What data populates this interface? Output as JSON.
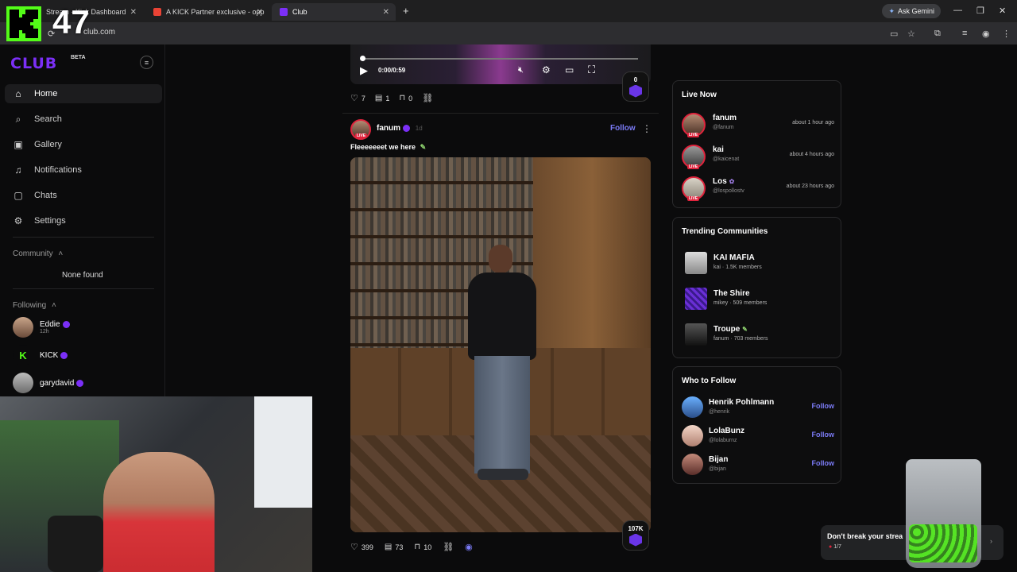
{
  "browser": {
    "tabs": [
      {
        "label": "Stream - Kick Dashboard",
        "color": "#53fc18"
      },
      {
        "label": "A KICK Partner exclusive - opp",
        "color": "#ea4335"
      },
      {
        "label": "Club",
        "color": "#7b2ff7"
      }
    ],
    "url": "club.com",
    "gemini_label": "Ask Gemini"
  },
  "overlay": {
    "viewer_count": "47"
  },
  "sidebar": {
    "logo": "CLUB",
    "beta": "BETA",
    "nav": [
      {
        "label": "Home",
        "icon": "home-icon"
      },
      {
        "label": "Search",
        "icon": "search-icon"
      },
      {
        "label": "Gallery",
        "icon": "gallery-icon"
      },
      {
        "label": "Notifications",
        "icon": "bell-icon"
      },
      {
        "label": "Chats",
        "icon": "chat-icon"
      },
      {
        "label": "Settings",
        "icon": "gear-icon"
      }
    ],
    "community_label": "Community",
    "community_empty": "None found",
    "following_label": "Following",
    "following": [
      {
        "name": "Eddie",
        "sub": "12h"
      },
      {
        "name": "KICK",
        "sub": ""
      },
      {
        "name": "garydavid",
        "sub": ""
      }
    ]
  },
  "video": {
    "time": "0:00/0:59",
    "likes": "7",
    "comments": "1",
    "bookmarks": "0",
    "gems": "0"
  },
  "post": {
    "author": "fanum",
    "age": "1d",
    "follow_label": "Follow",
    "caption": "Fleeeeeeet we here",
    "likes": "399",
    "comments": "73",
    "bookmarks": "10",
    "gems": "107K"
  },
  "live_now": {
    "title": "Live Now",
    "tag": "LIVE",
    "items": [
      {
        "name": "fanum",
        "handle": "@fanum",
        "time": "about 1 hour ago"
      },
      {
        "name": "kai",
        "handle": "@kaicenat",
        "time": "about 4 hours ago"
      },
      {
        "name": "Los",
        "handle": "@lospollostv",
        "time": "about 23 hours ago"
      }
    ]
  },
  "trending": {
    "title": "Trending Communities",
    "items": [
      {
        "name": "KAI MAFIA",
        "owner": "kai",
        "members": "1.5K members"
      },
      {
        "name": "The Shire",
        "owner": "mikey",
        "members": "509 members"
      },
      {
        "name": "Troupe",
        "owner": "fanum",
        "members": "703 members"
      }
    ]
  },
  "who_to_follow": {
    "title": "Who to Follow",
    "follow_label": "Follow",
    "items": [
      {
        "name": "Henrik Pohlmann",
        "handle": "@henrik"
      },
      {
        "name": "LolaBunz",
        "handle": "@lolaburnz"
      },
      {
        "name": "Bijan",
        "handle": "@bijan"
      }
    ]
  },
  "streak": {
    "text": "Don't break your strea",
    "progress": "1/7"
  },
  "colors": {
    "accent": "#7b2ff7",
    "kick_green": "#53fc18",
    "live_red": "#e0243d",
    "link": "#7b7bf6"
  }
}
